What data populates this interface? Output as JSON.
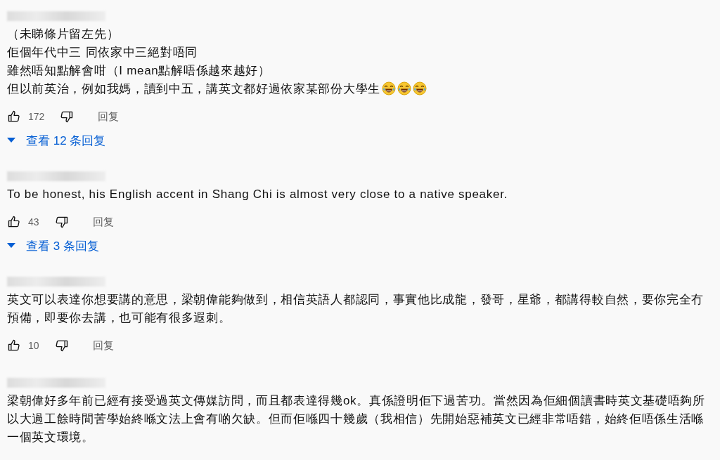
{
  "comments": [
    {
      "lines": [
        "（未睇條片留左先）",
        "佢個年代中三 同依家中三絕對唔同",
        "雖然唔知點解會咁（I mean點解唔係越來越好）",
        "但以前英治，例如我媽，讀到中五，講英文都好過依家某部份大學生"
      ],
      "emojis": [
        {
          "kind": "laughing"
        },
        {
          "kind": "laughing"
        },
        {
          "kind": "laughing"
        }
      ],
      "likes": "172",
      "reply_label": "回复",
      "view_replies": "查看 12 条回复"
    },
    {
      "lines": [
        "To be honest, his English accent in Shang Chi is almost very close to a native speaker."
      ],
      "likes": "43",
      "reply_label": "回复",
      "view_replies": "查看 3 条回复"
    },
    {
      "lines": [
        "英文可以表達你想要講的意思，梁朝偉能夠做到，相信英語人都認同，事實他比成龍，發哥，星爺，都講得較自然，要你完全冇預備，即要你去講，也可能有很多遐刺。"
      ],
      "likes": "10",
      "reply_label": "回复"
    },
    {
      "lines": [
        "梁朝偉好多年前已經有接受過英文傳媒訪問，而且都表達得幾ok。真係證明佢下過苦功。當然因為佢細個讀書時英文基礎唔夠所以大過工餘時間苦學始終喺文法上會有啲欠缺。但而佢喺四十幾歲（我相信）先開始惡補英文已經非常唔錯，始終佢唔係生活喺一個英文環境。"
      ]
    }
  ]
}
